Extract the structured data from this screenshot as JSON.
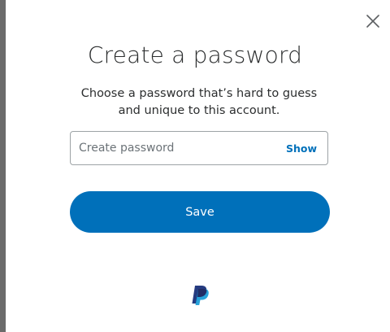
{
  "dialog": {
    "title": "Create a password",
    "subtitle": "Choose a password that’s hard to guess and unique to this account.",
    "password_field": {
      "value": "",
      "placeholder": "Create password",
      "show_label": "Show"
    },
    "save_label": "Save"
  },
  "icons": {
    "close": "close-icon",
    "brand": "paypal-logo-icon"
  },
  "colors": {
    "accent": "#0070ba",
    "text": "#2c2e2f",
    "placeholder": "#6c7378",
    "logo_dark": "#253b80",
    "logo_light": "#179bd7"
  }
}
